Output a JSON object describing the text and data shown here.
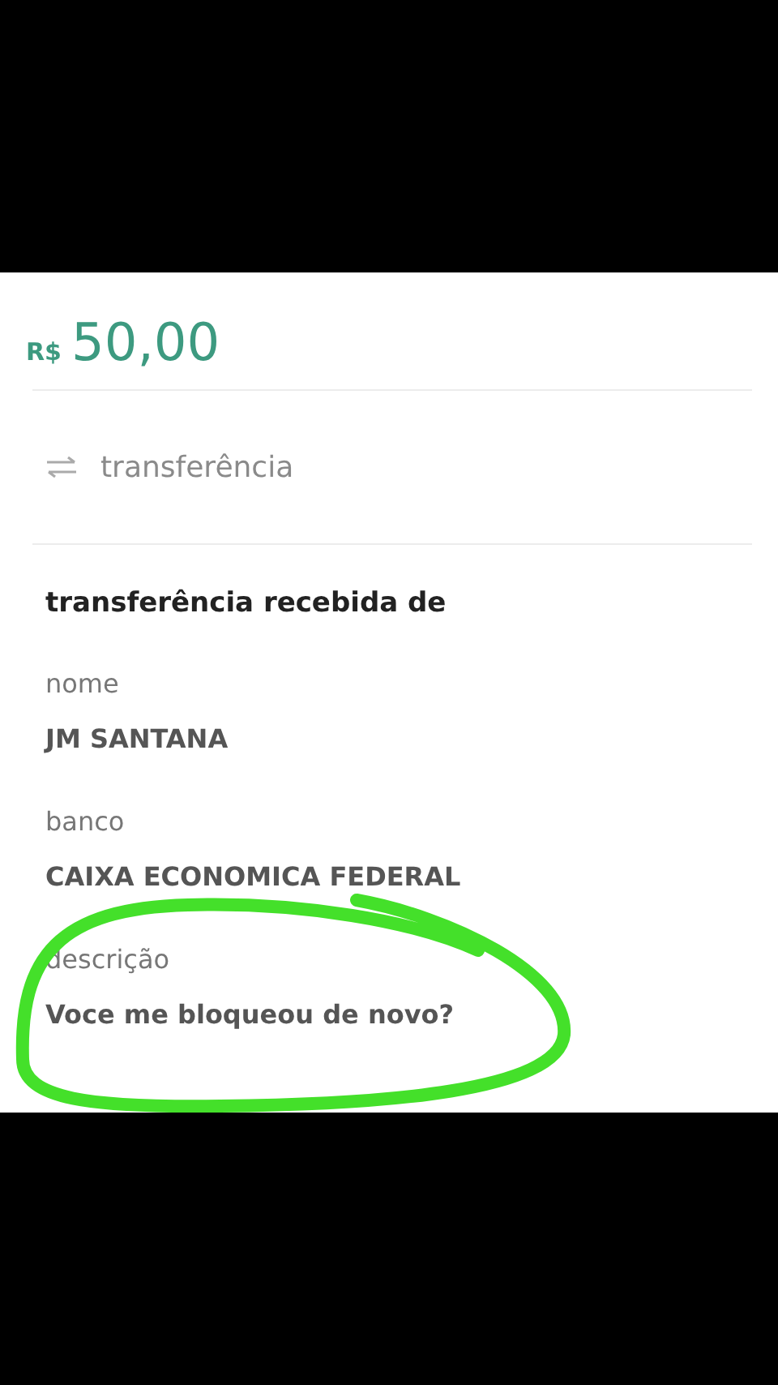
{
  "amount": {
    "currency": "R$",
    "value": "50,00"
  },
  "type": {
    "label": "transferência"
  },
  "section_title": "transferência recebida de",
  "fields": [
    {
      "label": "nome",
      "value": "JM SANTANA"
    },
    {
      "label": "banco",
      "value": "CAIXA ECONOMICA FEDERAL"
    },
    {
      "label": "descrição",
      "value": "Voce me bloqueou de novo?"
    }
  ]
}
